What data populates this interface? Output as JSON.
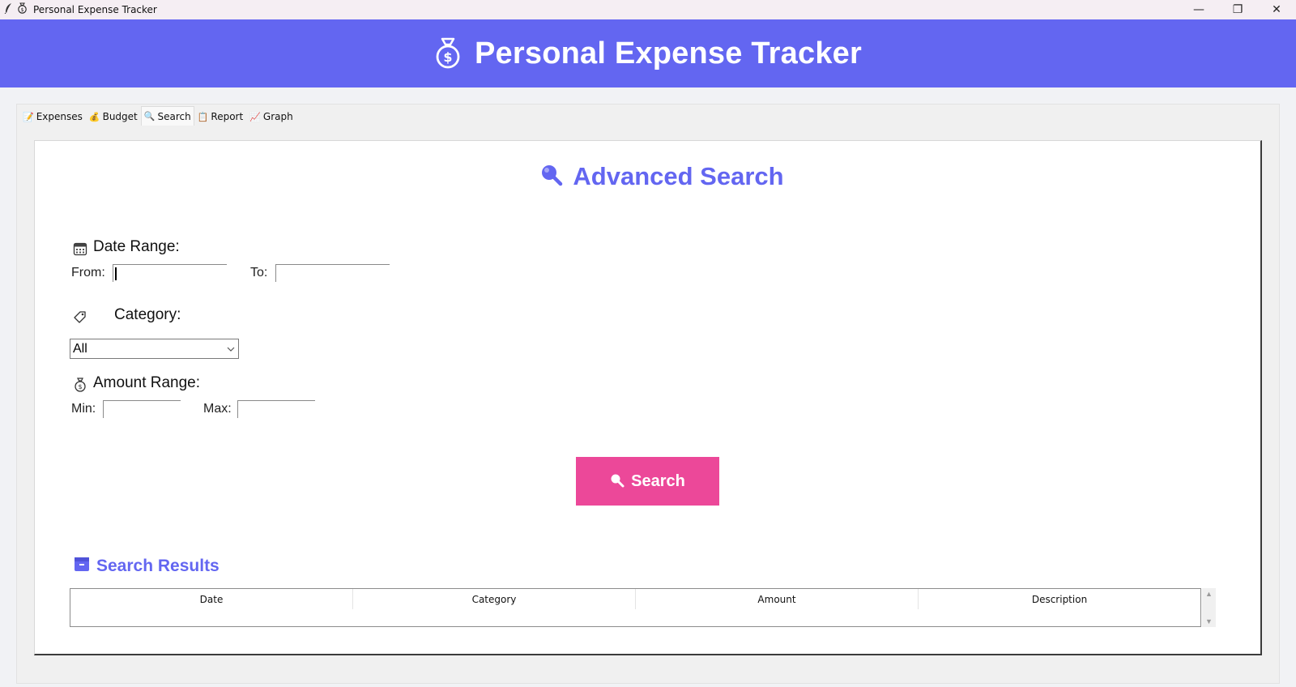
{
  "window": {
    "title": "Personal Expense Tracker",
    "controls": {
      "minimize": "—",
      "maximize": "❐",
      "close": "✕"
    }
  },
  "header": {
    "title": "Personal Expense Tracker",
    "icon": "money-bag-icon"
  },
  "tabs": [
    {
      "label": "Expenses",
      "icon": "memo-icon"
    },
    {
      "label": "Budget",
      "icon": "money-bag-icon"
    },
    {
      "label": "Search",
      "icon": "magnifier-icon"
    },
    {
      "label": "Report",
      "icon": "clipboard-icon"
    },
    {
      "label": "Graph",
      "icon": "chart-icon"
    }
  ],
  "active_tab": "Search",
  "search": {
    "title": "Advanced Search",
    "date_range": {
      "label": "Date Range:",
      "from_label": "From:",
      "from_value": "",
      "to_label": "To:",
      "to_value": ""
    },
    "category": {
      "label": "Category:",
      "selected": "All"
    },
    "amount_range": {
      "label": "Amount Range:",
      "min_label": "Min:",
      "min_value": "",
      "max_label": "Max:",
      "max_value": ""
    },
    "button_label": "Search"
  },
  "results": {
    "title": "Search Results",
    "columns": [
      "Date",
      "Category",
      "Amount",
      "Description"
    ],
    "rows": []
  },
  "colors": {
    "primary": "#6366f1",
    "button": "#ec4899",
    "titlebar": "#f5eef3"
  }
}
